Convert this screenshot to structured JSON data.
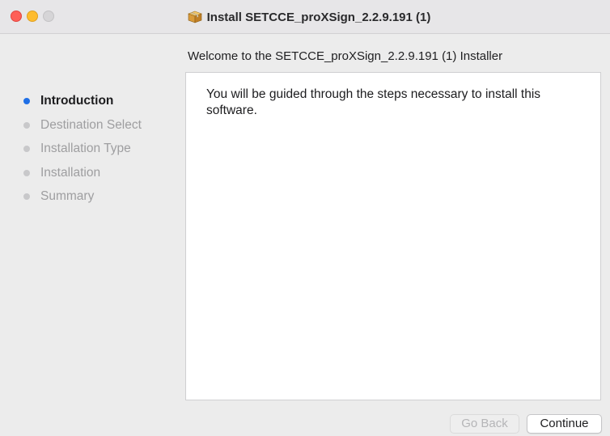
{
  "window": {
    "title": "Install SETCCE_proXSign_2.2.9.191 (1)",
    "title_icon": "package-icon"
  },
  "colors": {
    "close": "#fe5f57",
    "minimize": "#febc2e",
    "zoom_disabled": "#d6d5d7",
    "active_step": "#1f6fe6"
  },
  "welcome": "Welcome to the SETCCE_proXSign_2.2.9.191 (1) Installer",
  "steps": [
    {
      "label": "Introduction",
      "active": true
    },
    {
      "label": "Destination Select",
      "active": false
    },
    {
      "label": "Installation Type",
      "active": false
    },
    {
      "label": "Installation",
      "active": false
    },
    {
      "label": "Summary",
      "active": false
    }
  ],
  "content": {
    "text": "You will be guided through the steps necessary to install this software."
  },
  "buttons": {
    "back_label": "Go Back",
    "back_enabled": false,
    "continue_label": "Continue"
  }
}
